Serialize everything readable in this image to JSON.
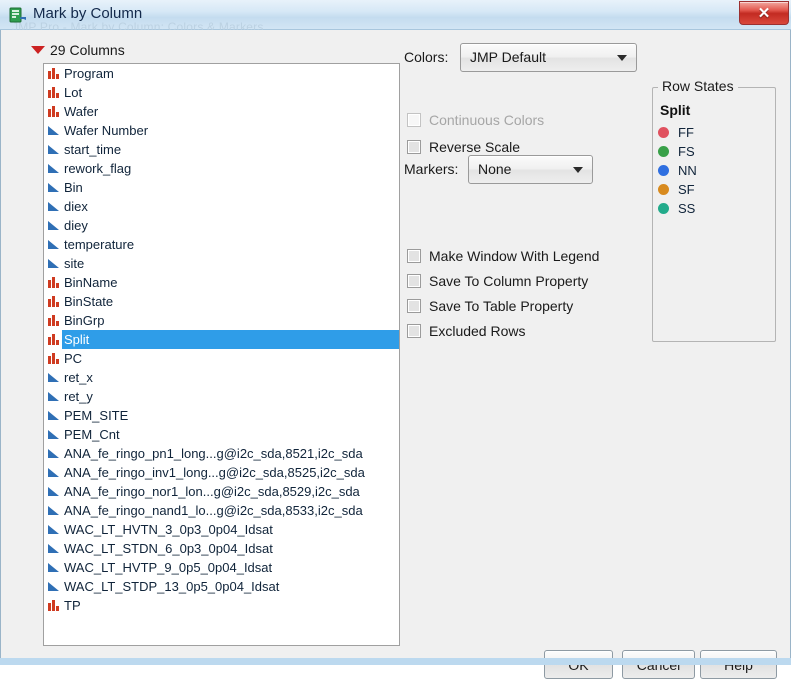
{
  "window": {
    "title": "Mark by Column",
    "ghost_title": "JMP Pro - Mark by Column: Colors & Markers",
    "icon": "jmp-column-icon",
    "close_label": "✕"
  },
  "columns_panel": {
    "count_label": "29 Columns",
    "disclosure_icon": "red-triangle-down-icon",
    "selected": "Split",
    "items": [
      {
        "label": "Program",
        "type": "nominal"
      },
      {
        "label": "Lot",
        "type": "nominal"
      },
      {
        "label": "Wafer",
        "type": "nominal"
      },
      {
        "label": "Wafer Number",
        "type": "continuous"
      },
      {
        "label": "start_time",
        "type": "continuous"
      },
      {
        "label": "rework_flag",
        "type": "continuous"
      },
      {
        "label": "Bin",
        "type": "continuous"
      },
      {
        "label": "diex",
        "type": "continuous"
      },
      {
        "label": "diey",
        "type": "continuous"
      },
      {
        "label": "temperature",
        "type": "continuous"
      },
      {
        "label": "site",
        "type": "continuous"
      },
      {
        "label": "BinName",
        "type": "nominal"
      },
      {
        "label": "BinState",
        "type": "nominal"
      },
      {
        "label": "BinGrp",
        "type": "nominal"
      },
      {
        "label": "Split",
        "type": "nominal"
      },
      {
        "label": "PC",
        "type": "nominal"
      },
      {
        "label": "ret_x",
        "type": "continuous"
      },
      {
        "label": "ret_y",
        "type": "continuous"
      },
      {
        "label": "PEM_SITE",
        "type": "continuous"
      },
      {
        "label": "PEM_Cnt",
        "type": "continuous"
      },
      {
        "label": "ANA_fe_ringo_pn1_long...g@i2c_sda,8521,i2c_sda",
        "type": "continuous"
      },
      {
        "label": "ANA_fe_ringo_inv1_long...g@i2c_sda,8525,i2c_sda",
        "type": "continuous"
      },
      {
        "label": "ANA_fe_ringo_nor1_lon...g@i2c_sda,8529,i2c_sda",
        "type": "continuous"
      },
      {
        "label": "ANA_fe_ringo_nand1_lo...g@i2c_sda,8533,i2c_sda",
        "type": "continuous"
      },
      {
        "label": "WAC_LT_HVTN_3_0p3_0p04_Idsat",
        "type": "continuous"
      },
      {
        "label": "WAC_LT_STDN_6_0p3_0p04_Idsat",
        "type": "continuous"
      },
      {
        "label": "WAC_LT_HVTP_9_0p5_0p04_Idsat",
        "type": "continuous"
      },
      {
        "label": "WAC_LT_STDP_13_0p5_0p04_Idsat",
        "type": "continuous"
      },
      {
        "label": "TP",
        "type": "nominal"
      }
    ]
  },
  "options": {
    "colors_label": "Colors:",
    "colors_value": "JMP Default",
    "markers_label": "Markers:",
    "markers_value": "None",
    "checkboxes": [
      {
        "label": "Continuous Colors",
        "checked": false,
        "disabled": true
      },
      {
        "label": "Reverse Scale",
        "checked": false,
        "disabled": false
      },
      {
        "label": "Make Window With Legend",
        "checked": false,
        "disabled": false
      },
      {
        "label": "Save To Column Property",
        "checked": false,
        "disabled": false
      },
      {
        "label": "Save To Table Property",
        "checked": false,
        "disabled": false
      },
      {
        "label": "Excluded Rows",
        "checked": false,
        "disabled": false
      }
    ]
  },
  "row_states": {
    "group_title": "Row States",
    "column_name": "Split",
    "levels": [
      {
        "label": "FF",
        "color": "#e0515f"
      },
      {
        "label": "FS",
        "color": "#38a048"
      },
      {
        "label": "NN",
        "color": "#2f6fe0"
      },
      {
        "label": "SF",
        "color": "#d88a1e"
      },
      {
        "label": "SS",
        "color": "#22ab8b"
      }
    ]
  },
  "buttons": {
    "ok": "OK",
    "cancel": "Cancel",
    "help": "Help"
  }
}
